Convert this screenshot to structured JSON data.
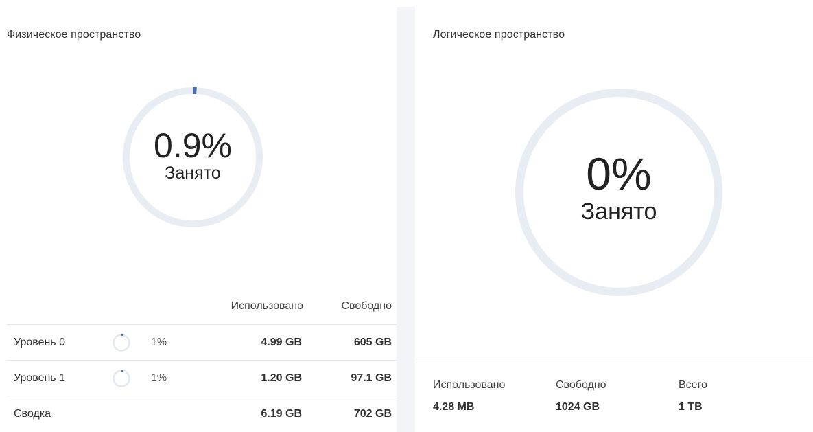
{
  "physical": {
    "title": "Физическое пространство",
    "donut": {
      "percent_text": "0.9%",
      "label": "Занято",
      "fraction": 0.009,
      "track_color": "#e8ecf3",
      "fill_color": "#4a6fa5"
    },
    "table": {
      "columns": {
        "used": "Использовано",
        "free": "Свободно"
      },
      "rows": [
        {
          "name": "Уровень 0",
          "percent": "1%",
          "fraction": 0.01,
          "used": "4.99 GB",
          "free": "605 GB"
        },
        {
          "name": "Уровень 1",
          "percent": "1%",
          "fraction": 0.01,
          "used": "1.20 GB",
          "free": "97.1 GB"
        },
        {
          "name": "Сводка",
          "used": "6.19 GB",
          "free": "702 GB"
        }
      ]
    }
  },
  "logical": {
    "title": "Логическое пространство",
    "donut": {
      "percent_text": "0%",
      "label": "Занято",
      "fraction": 0,
      "track_color": "#e8ecf3"
    },
    "stats": {
      "used_label": "Использовано",
      "used_value": "4.28 MB",
      "free_label": "Свободно",
      "free_value": "1024 GB",
      "total_label": "Всего",
      "total_value": "1 TB"
    }
  }
}
